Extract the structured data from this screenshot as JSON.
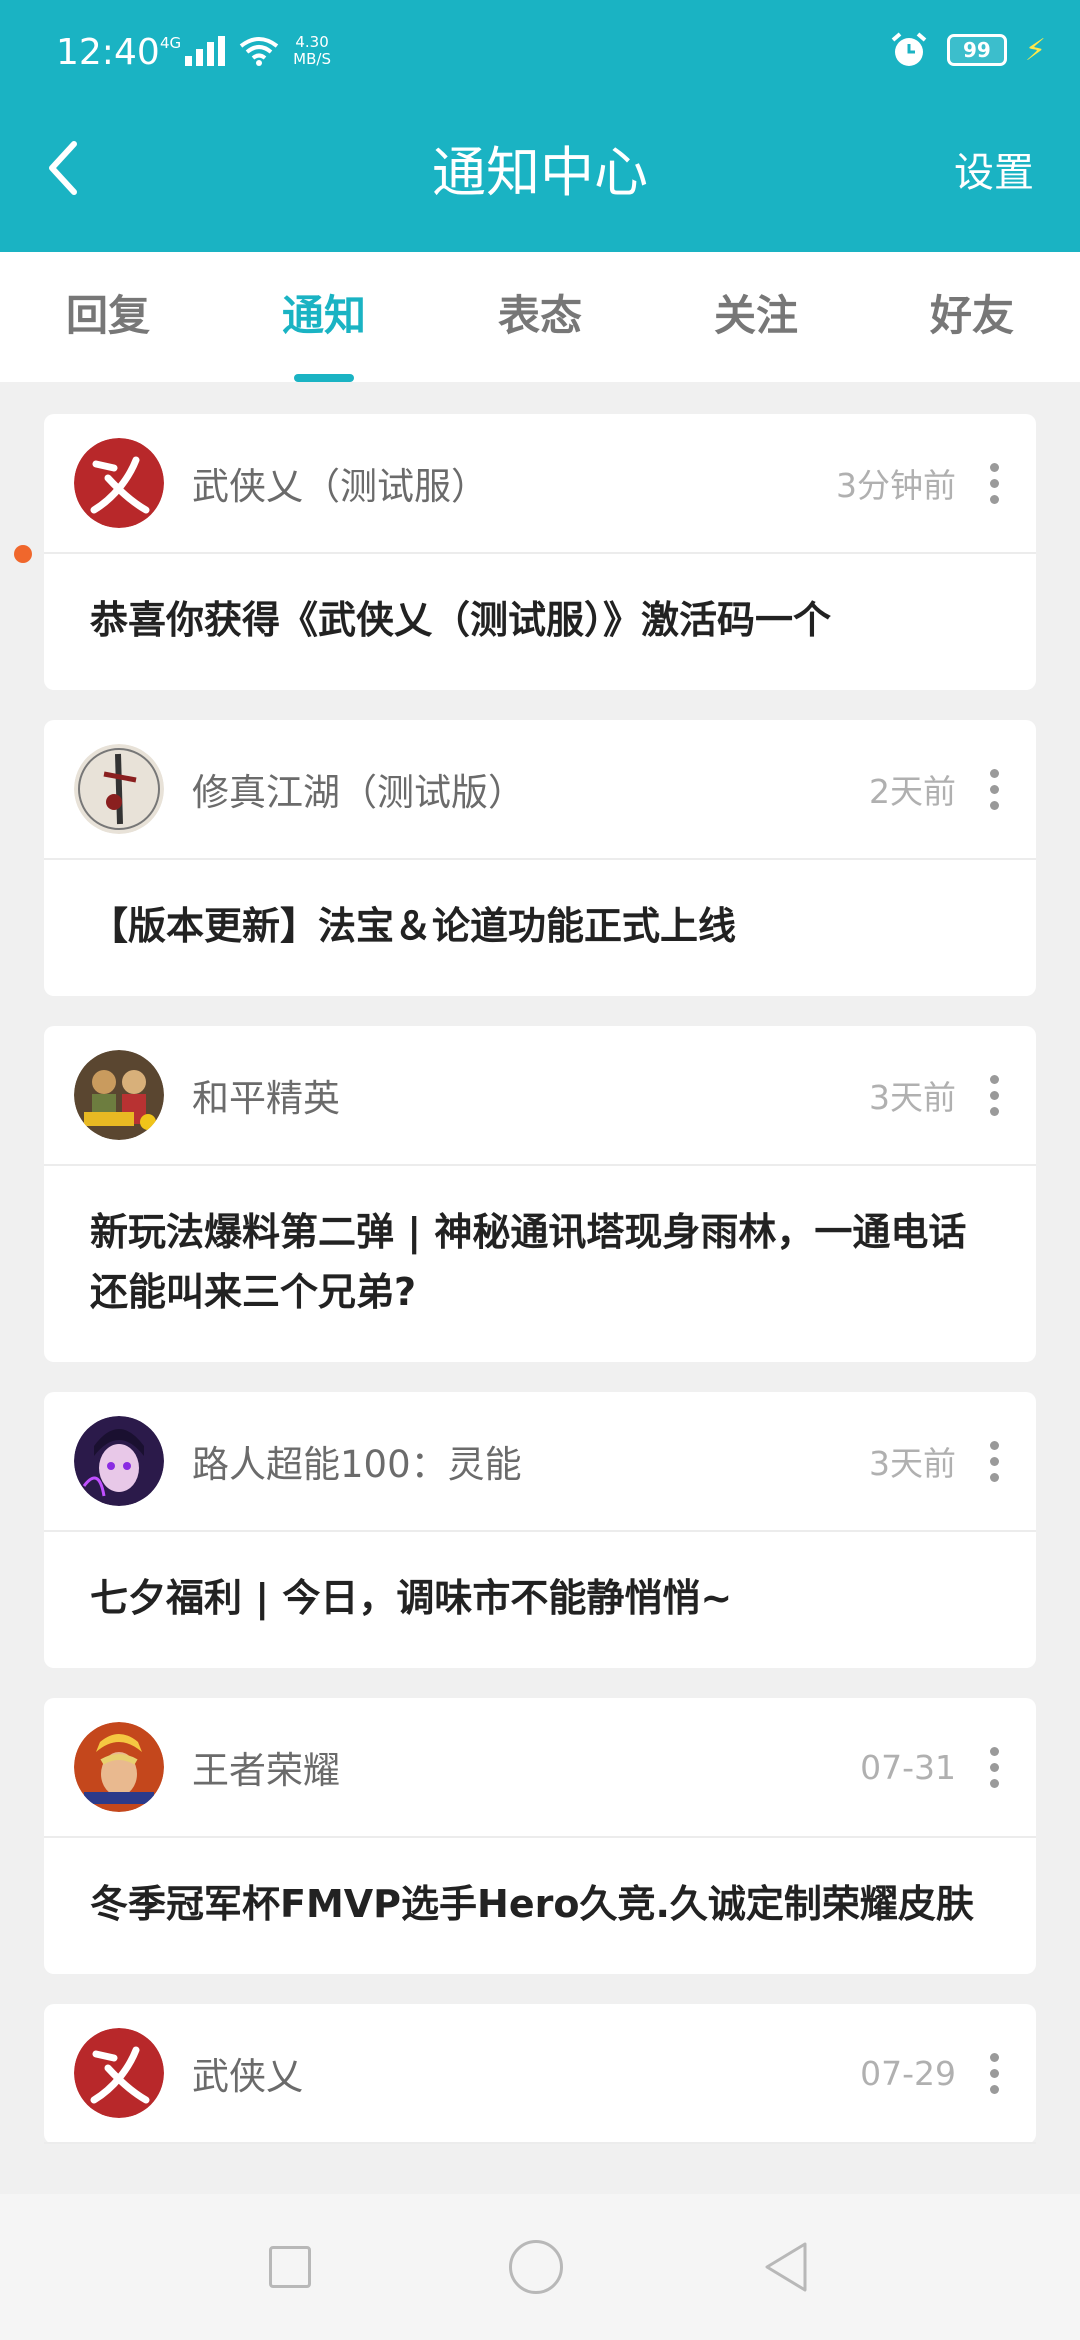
{
  "status": {
    "time": "12:40",
    "network": "4G",
    "speed_value": "4.30",
    "speed_unit": "MB/S",
    "battery": "99"
  },
  "header": {
    "title": "通知中心",
    "settings_label": "设置"
  },
  "tabs": [
    {
      "label": "回复"
    },
    {
      "label": "通知",
      "active": true
    },
    {
      "label": "表态"
    },
    {
      "label": "关注"
    },
    {
      "label": "好友"
    }
  ],
  "notifications": [
    {
      "source": "武侠乂（测试服）",
      "time": "3分钟前",
      "text": "恭喜你获得《武侠乂（测试服）》激活码一个",
      "avatar": "wuxia-logo",
      "unread": true
    },
    {
      "source": "修真江湖（测试版）",
      "time": "2天前",
      "text": "【版本更新】法宝＆论道功能正式上线",
      "avatar": "xiuzhen-logo"
    },
    {
      "source": "和平精英",
      "time": "3天前",
      "text": "新玩法爆料第二弹 | 神秘通讯塔现身雨林，一通电话还能叫来三个兄弟?",
      "avatar": "peace-elite-logo"
    },
    {
      "source": "路人超能100：灵能",
      "time": "3天前",
      "text": "七夕福利 | 今日，调味市不能静悄悄~",
      "avatar": "mob-psycho-logo"
    },
    {
      "source": "王者荣耀",
      "time": "07-31",
      "text": "冬季冠军杯FMVP选手Hero久竞.久诚定制荣耀皮肤",
      "avatar": "honor-of-kings-logo"
    },
    {
      "source": "武侠乂",
      "time": "07-29",
      "text": "",
      "avatar": "wuxia-logo"
    }
  ],
  "colors": {
    "accent": "#1ab3c3",
    "unread_dot": "#f0672c",
    "battery_bolt": "#ffe94a"
  }
}
